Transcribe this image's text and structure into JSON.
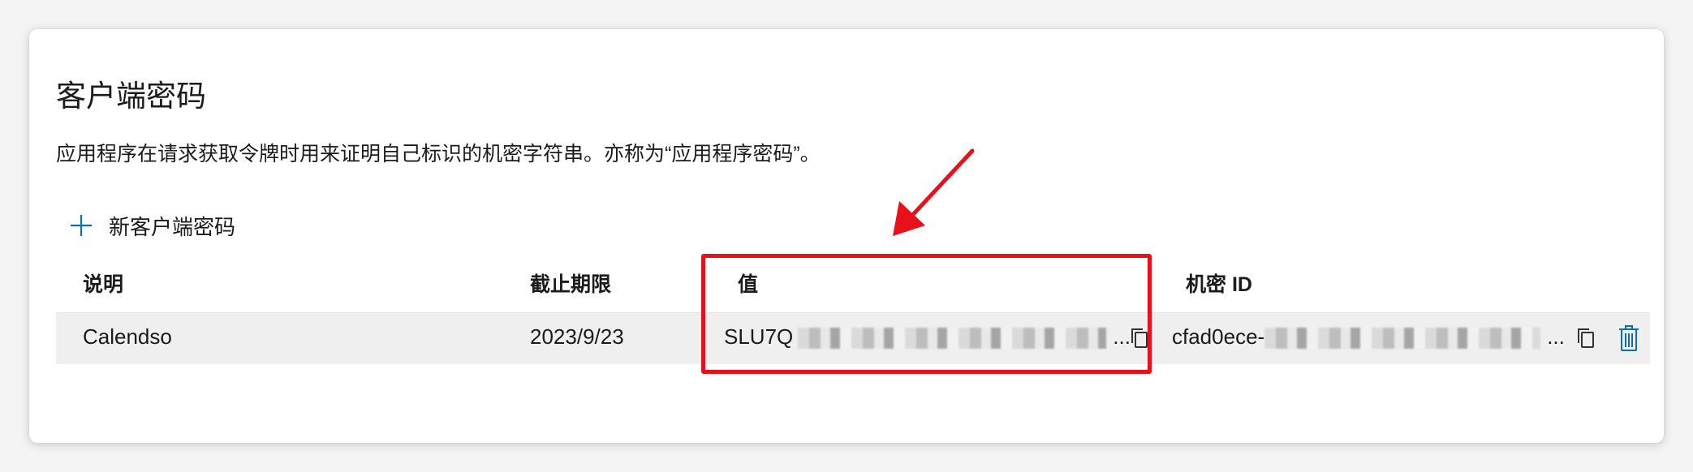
{
  "section": {
    "title": "客户端密码",
    "description": "应用程序在请求获取令牌时用来证明自己标识的机密字符串。亦称为“应用程序密码”。",
    "add_button_label": "新客户端密码"
  },
  "table": {
    "columns": [
      "说明",
      "截止期限",
      "值",
      "机密 ID"
    ],
    "rows": [
      {
        "description": "Calendso",
        "expires": "2023/9/23",
        "value_prefix": "SLU7Q",
        "value_suffix": "...",
        "secret_id_prefix": "cfad0ece-",
        "secret_id_suffix": "..."
      }
    ]
  },
  "icons": {
    "add": "plus-icon",
    "copy": "copy-icon",
    "delete": "trash-icon"
  },
  "colors": {
    "accent": "#0f6cbd",
    "highlight": "#e8101b",
    "row_background": "#efefef"
  }
}
